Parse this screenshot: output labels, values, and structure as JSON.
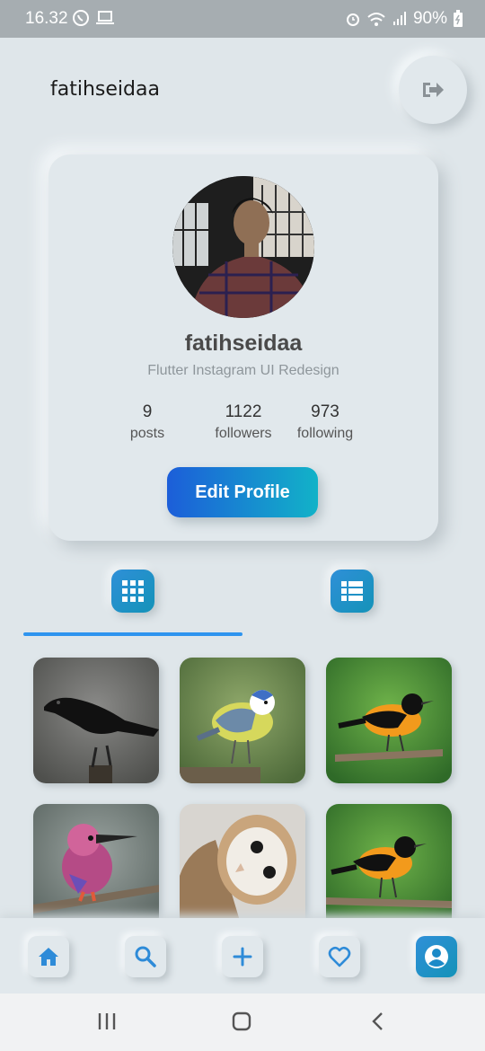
{
  "status_bar": {
    "time": "16.32",
    "battery": "90%"
  },
  "header": {
    "username": "fatihseidaa"
  },
  "profile": {
    "name": "fatihseidaa",
    "bio": "Flutter Instagram UI Redesign",
    "stats": [
      {
        "value": "9",
        "label": "posts"
      },
      {
        "value": "1122",
        "label": "followers"
      },
      {
        "value": "973",
        "label": "following"
      }
    ],
    "edit_label": "Edit Profile"
  },
  "colors": {
    "accent": "#2e94ef",
    "gradient_start": "#1c5ed9",
    "gradient_end": "#12b2c8",
    "background": "#dfe6ea"
  },
  "tabs": [
    {
      "icon": "grid-icon",
      "selected": true
    },
    {
      "icon": "list-icon",
      "selected": false
    }
  ],
  "posts": [
    {
      "subject": "crow"
    },
    {
      "subject": "blue tit"
    },
    {
      "subject": "oriole"
    },
    {
      "subject": "kingfisher"
    },
    {
      "subject": "owl"
    },
    {
      "subject": "oriole"
    }
  ],
  "bottom_nav": [
    {
      "icon": "home-icon",
      "active": false
    },
    {
      "icon": "search-icon",
      "active": false
    },
    {
      "icon": "plus-icon",
      "active": false
    },
    {
      "icon": "heart-icon",
      "active": false
    },
    {
      "icon": "profile-icon",
      "active": true
    }
  ]
}
